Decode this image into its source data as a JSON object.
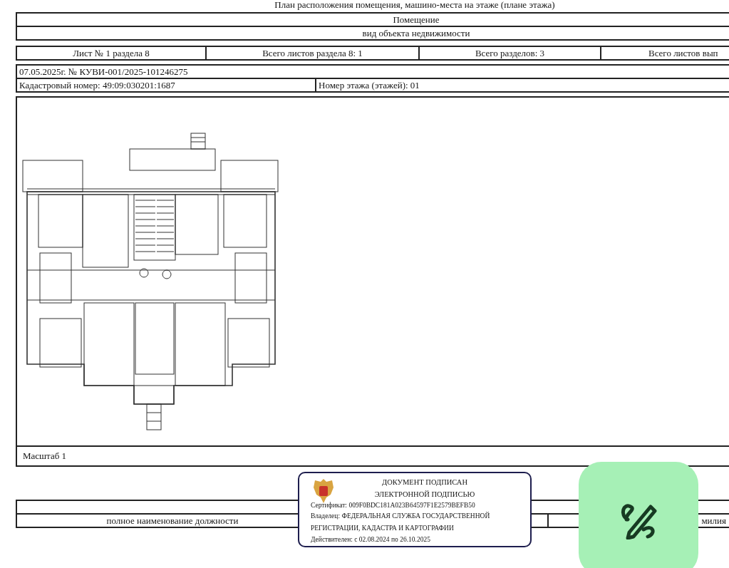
{
  "document": {
    "title": "План расположения помещения, машино-места на этаже (плане этажа)",
    "header_rows": [
      "Помещение",
      "вид объекта недвижимости"
    ],
    "sheet_info": [
      "Лист № 1 раздела 8",
      "Всего листов раздела 8: 1",
      "Всего разделов: 3",
      "Всего листов вып"
    ],
    "extract_number": "07.05.2025г. № КУВИ-001/2025-101246275",
    "cadastral_number": "Кадастровый номер: 49:09:030201:1687",
    "floor_number": "Номер этажа (этажей): 01",
    "scale": "Масштаб 1",
    "signature_row": {
      "position_caption": "полное наименование должности",
      "surname_caption": "милия"
    }
  },
  "signature_stamp": {
    "lines": [
      "ДОКУМЕНТ ПОДПИСАН",
      "ЭЛЕКТРОННОЙ ПОДПИСЬЮ"
    ],
    "certificate": "Сертификат: 009F0BDC181A023B64597F1E2579BEFB50",
    "owner": "Владелец: ФЕДЕРАЛЬНАЯ СЛУЖБА ГОСУДАРСТВЕННОЙ РЕГИСТРАЦИИ, КАДАСТРА И КАРТОГРАФИИ",
    "validity": "Действителен: с 02.08.2024 по 26.10.2025"
  }
}
